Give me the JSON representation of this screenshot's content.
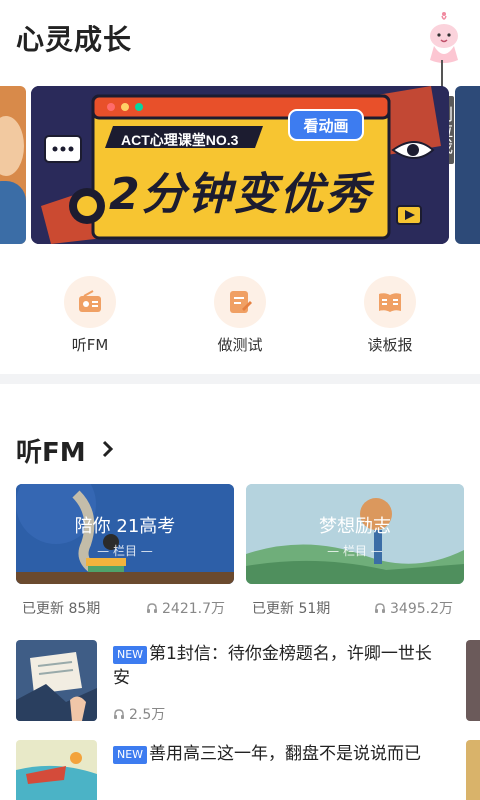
{
  "header": {
    "title": "心灵成长",
    "pull_tab_text": "别拉我"
  },
  "banner": {
    "tag": "ACT心理课堂NO.3",
    "badge": "看动画",
    "headline": "2分钟变优秀"
  },
  "quick_nav": [
    {
      "label": "听FM",
      "icon": "radio-icon"
    },
    {
      "label": "做测试",
      "icon": "quiz-icon"
    },
    {
      "label": "读板报",
      "icon": "book-icon"
    }
  ],
  "fm_section": {
    "title": "听FM",
    "cards": [
      {
        "title": "陪你 21高考",
        "subtitle": "— 栏目 —",
        "updates": "已更新 85期",
        "plays": "2421.7万"
      },
      {
        "title": "梦想励志",
        "subtitle": "— 栏目 —",
        "updates": "已更新 51期",
        "plays": "3495.2万"
      }
    ]
  },
  "episodes": [
    {
      "badge": "NEW",
      "title": "第1封信：待你金榜题名，许卿一世长安",
      "plays": "2.5万"
    },
    {
      "badge": "NEW",
      "title": "善用高三这一年，翻盘不是说说而已",
      "plays": ""
    }
  ],
  "colors": {
    "accent_blue": "#3d7cf0",
    "icon_orange": "#f0a064",
    "icon_bg": "#fdf0e6",
    "banner_yellow": "#f7c531",
    "banner_red": "#e8502a"
  }
}
